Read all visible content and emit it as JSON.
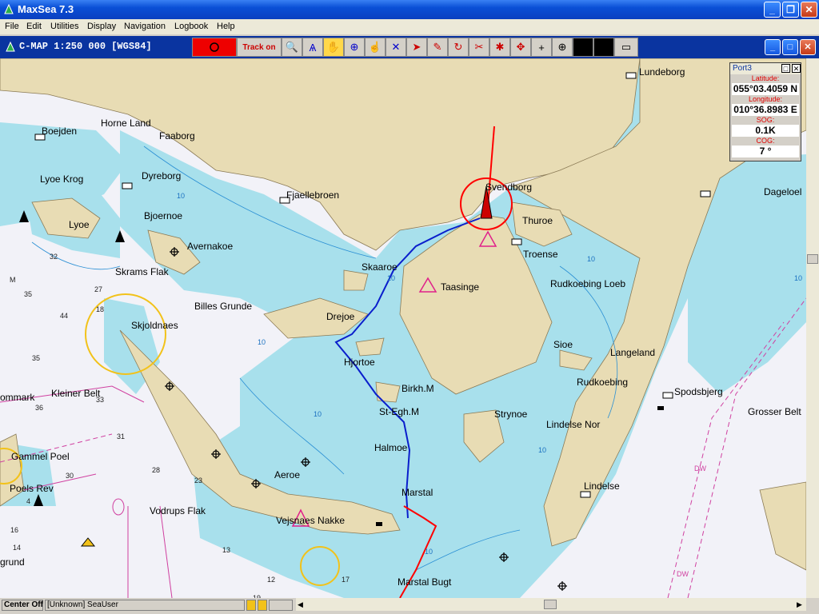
{
  "window": {
    "title": "MaxSea 7.3"
  },
  "menu": [
    "File",
    "Edit",
    "Utilities",
    "Display",
    "Navigation",
    "Logbook",
    "Help"
  ],
  "chart_window": {
    "title": "C-MAP  1:250 000 [WGS84]"
  },
  "toolbar": {
    "track_label": "Track on"
  },
  "port": {
    "title": "Port3",
    "lat_label": "Latitude:",
    "lat_value": "055°03.4059 N",
    "lon_label": "Longitude:",
    "lon_value": "010°36.8983 E",
    "sog_label": "SOG:",
    "sog_value": "0.1K",
    "cog_label": "COG:",
    "cog_value": "7 °"
  },
  "status": {
    "center": "Center Off",
    "user": "[Unknown]  SeaUser"
  },
  "places": {
    "horne_land": "Horne Land",
    "faaborg": "Faaborg",
    "boejden": "Boejden",
    "lyoe_krog": "Lyoe Krog",
    "dyreborg": "Dyreborg",
    "bjoernoe": "Bjoernoe",
    "lyoe": "Lyoe",
    "avernakoe": "Avernakoe",
    "skrams_flak": "Skrams Flak",
    "fjaellebroen": "Fjaellebroen",
    "svendborg": "Svendborg",
    "thuroe": "Thuroe",
    "troense": "Troense",
    "lundeborg": "Lundeborg",
    "dageloe": "Dageloel",
    "skaaroe": "Skaaroe",
    "taasinge": "Taasinge",
    "rudkoebing_loeb": "Rudkoebing Loeb",
    "billes_grunde": "Billes Grunde",
    "drejoe": "Drejoe",
    "skjoldnaes": "Skjoldnaes",
    "hjortoe": "Hjortoe",
    "sioe": "Sioe",
    "langeland": "Langeland",
    "birkh": "Birkh.M",
    "rudkoebing": "Rudkoebing",
    "kleiner_belt": "Kleiner Belt",
    "st_egh": "St-Egh.M",
    "strynoe": "Strynoe",
    "lindelse_nor": "Lindelse Nor",
    "spodsbjerg": "Spodsbjerg",
    "grosser_belt": "Grosser Belt",
    "gammel_poel": "Gammel Poel",
    "halmoe": "Halmoe",
    "aeroe": "Aeroe",
    "poels_rev": "Poels Rev",
    "marstal": "Marstal",
    "lindelse": "Lindelse",
    "vodrups_flak": "Vodrups Flak",
    "vejsnaes_nakke": "Vejsnaes Nakke",
    "marstal_bugt": "Marstal Bugt",
    "ommark": "ommark",
    "grund": "grund"
  },
  "depths": {
    "d32": "32",
    "d35": "35",
    "d44": "44",
    "d27": "27",
    "d35b": "35",
    "d36": "36",
    "d33": "33",
    "d31": "31",
    "d30": "30",
    "d28": "28",
    "d23": "23",
    "d18": "18",
    "d4": "4",
    "d16": "16",
    "d14": "14",
    "d13": "13",
    "d17": "17",
    "d12": "12",
    "d19": "19",
    "d10a": "10",
    "d10b": "10",
    "d10c": "10",
    "d10d": "10",
    "d10e": "10",
    "d10f": "10",
    "d10g": "10",
    "d10h": "10",
    "m": "M",
    "dw1": "DW",
    "dw2": "DW"
  },
  "colors": {
    "land": "#e8dcb4",
    "shallow": "#a8e0ec",
    "deep": "#f0f0f6",
    "track": "#0a1ecc",
    "heading": "#ff0000",
    "circle": "#f2c21a"
  }
}
